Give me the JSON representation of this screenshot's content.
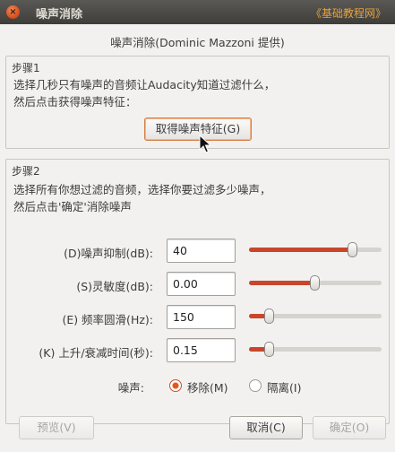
{
  "window": {
    "title": "噪声消除",
    "watermark": "《基础教程网》",
    "close_glyph": "×"
  },
  "dialog": {
    "heading": "噪声消除(Dominic Mazzoni 提供)",
    "step1": {
      "label": "步骤1",
      "line1": "选择几秒只有噪声的音频让Audacity知道过滤什么，",
      "line2": "然后点击获得噪声特征：",
      "button": "取得噪声特征(G)"
    },
    "step2": {
      "label": "步骤2",
      "line1": "选择所有你想过滤的音频，选择你要过滤多少噪声，",
      "line2": "然后点击'确定'消除噪声"
    },
    "params": [
      {
        "label": "(D)噪声抑制(dB):",
        "value": "40",
        "level": 0.78
      },
      {
        "label": "(S)灵敏度(dB):",
        "value": "0.00",
        "level": 0.49
      },
      {
        "label": "(E) 频率圆滑(Hz):",
        "value": "150",
        "level": 0.15
      },
      {
        "label": "(K) 上升/衰减时间(秒):",
        "value": "0.15",
        "level": 0.15
      }
    ],
    "noise": {
      "label": "噪声:",
      "options": [
        {
          "text": "移除(M)",
          "checked": true
        },
        {
          "text": "隔离(I)",
          "checked": false
        }
      ]
    },
    "buttons": {
      "preview": "预览(V)",
      "cancel": "取消(C)",
      "ok": "确定(O)"
    }
  },
  "colors": {
    "accent": "#c9462c",
    "focus": "#d77f46",
    "titlebar": "#3e3d39",
    "background": "#f2f1f0"
  }
}
